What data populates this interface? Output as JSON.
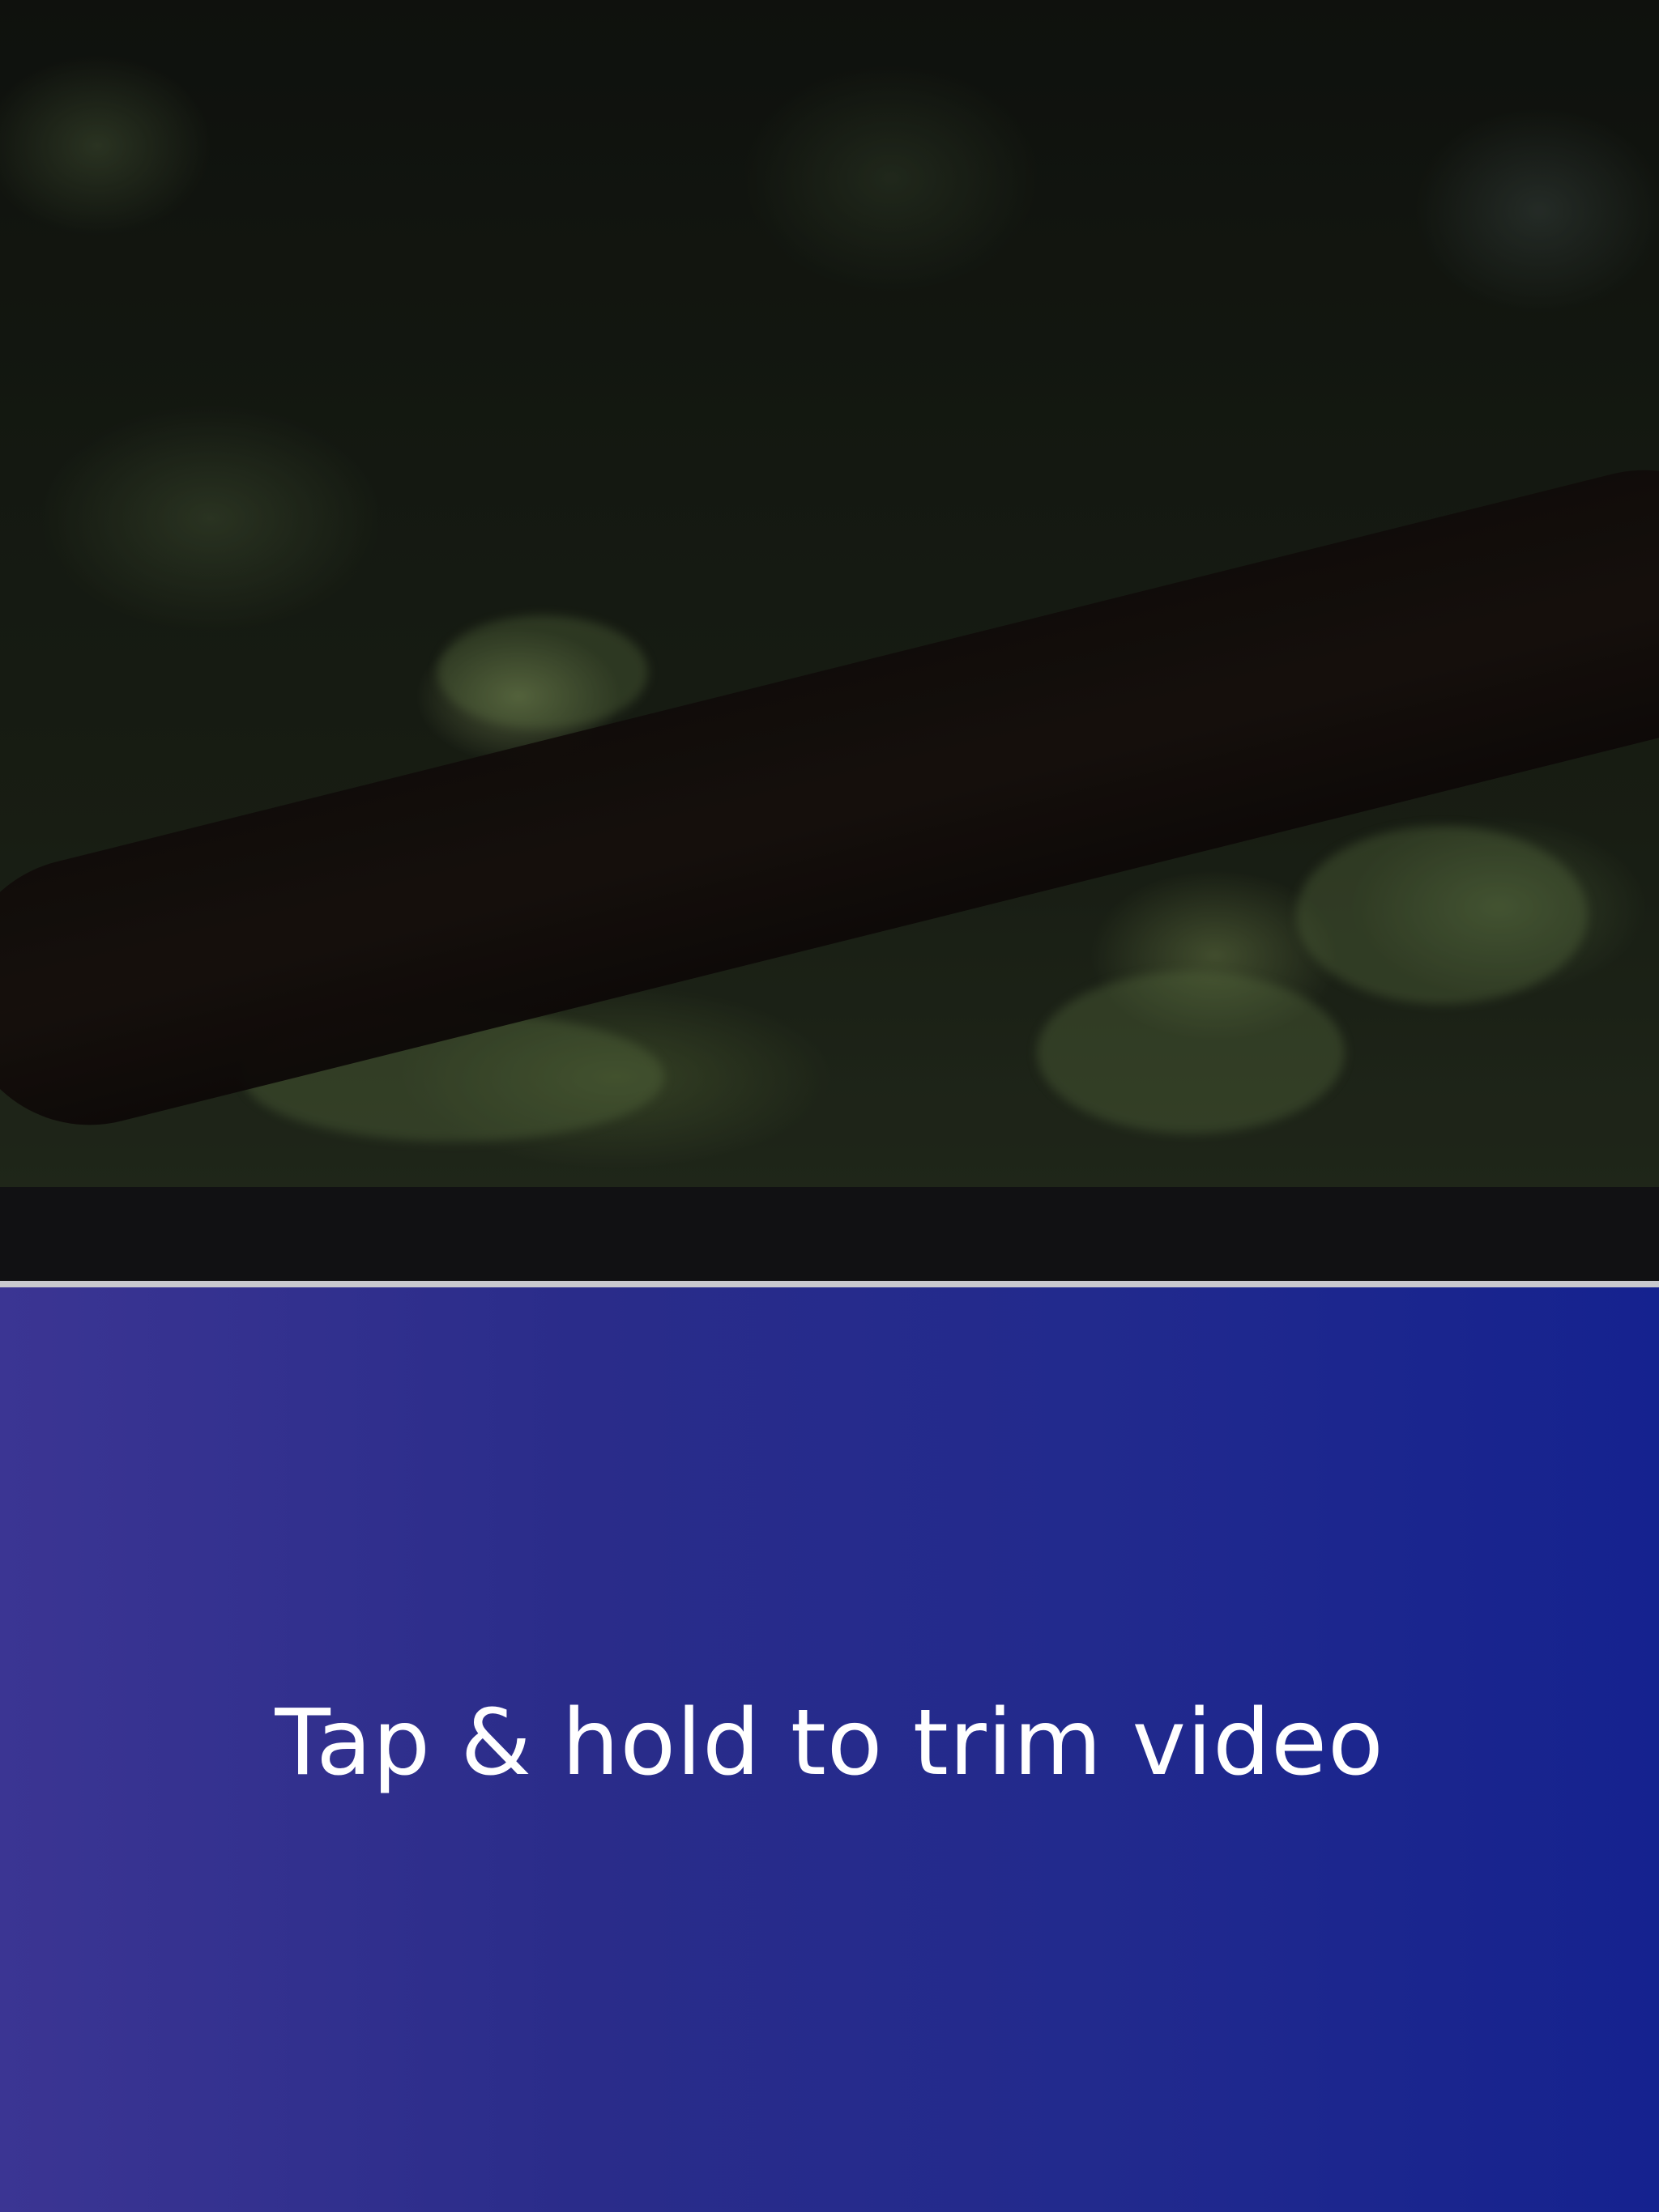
{
  "video": {
    "description_icon": "video-preview"
  },
  "hint": {
    "text": "Tap & hold to trim video"
  },
  "colors": {
    "strip": "#111113",
    "timeline": "#c9c9cf",
    "gradient_start": "#3b3593",
    "gradient_end": "#15228f",
    "text": "#ffffff"
  }
}
